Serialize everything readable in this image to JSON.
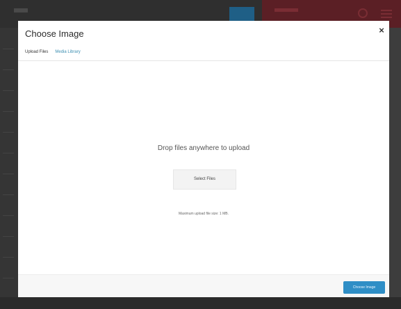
{
  "modal": {
    "title": "Choose Image",
    "tabs": [
      {
        "label": "Upload Files"
      },
      {
        "label": "Media Library"
      }
    ],
    "drop_text": "Drop files anywhere to upload",
    "select_files_label": "Select Files",
    "max_upload_text": "Maximum upload file size: 1 MB.",
    "choose_button_label": "Choose Image",
    "close_icon": "close-icon"
  },
  "colors": {
    "accent": "#2f8ec6",
    "tab_link": "#3b8eb1",
    "overlay_red": "#5b1f25"
  }
}
